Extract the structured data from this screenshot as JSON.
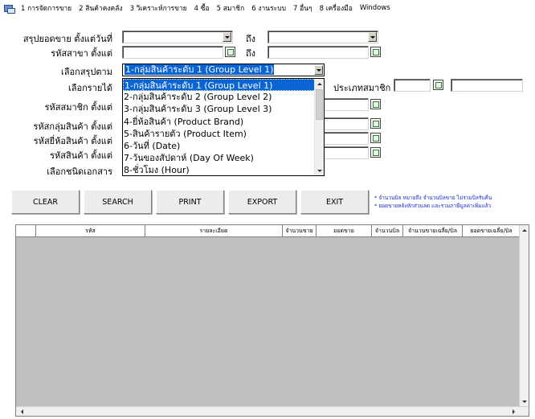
{
  "menu": {
    "items": [
      "1 การจัดการขาย",
      "2 สินค้าคงคลัง",
      "3 วิเคราะห์การขาย",
      "4 ซื้อ",
      "5 สมาชิก",
      "6 งานระบบ",
      "7 อื่นๆ",
      "8 เครื่องมือ",
      "Windows"
    ]
  },
  "form": {
    "labels": {
      "summary_date": "สรุปยอดขาย ตั้งแต่วันที่",
      "branch_code": "รหัสสาขา ตั้งแต่",
      "select_summary": "เลือกสรุปตาม",
      "select_tx": "เลือกรายได้",
      "member_code": "รหัสสมาชิก ตั้งแต่",
      "product_group": "รหัสกลุ่มสินค้า ตั้งแต่",
      "brand_code": "รหัสยี่ห้อสินค้า ตั้งแต่",
      "product_code": "รหัสสินค้า ตั้งแต่",
      "doc_type": "เลือกชนิดเอกสาร",
      "to1": "ถึง",
      "to2": "ถึง",
      "member_type": "ประเภทสมาชิก"
    },
    "summary_selected": "1-กลุ่มสินค้าระดับ 1 (Group Level 1)",
    "summary_options": [
      "1-กลุ่มสินค้าระดับ 1 (Group Level 1)",
      "2-กลุ่มสินค้าระดับ 2 (Group Level 2)",
      "3-กลุ่มสินค้าระดับ 3 (Group Level 3)",
      "4-ยี่ห้อสินค้า (Product Brand)",
      "5-สินค้ารายตัว (Product Item)",
      "6-วันที่ (Date)",
      "7-วันของสัปดาห์ (Day Of Week)",
      "8-ชั่วโมง (Hour)"
    ]
  },
  "buttons": {
    "clear": "CLEAR",
    "search": "SEARCH",
    "print": "PRINT",
    "export": "EXPORT",
    "exit": "EXIT"
  },
  "note": {
    "line1": "* จำนวนบิล หมายถึง จำนวนบิลขาย ไม่รวมบิลรับคืน",
    "line2": "* ยอดขายหลังหักส่วนลด และรวมภาษีมูลค่าเพิ่มแล้ว"
  },
  "grid": {
    "columns": [
      "รหัส",
      "รายละเอียด",
      "จำนวนขาย",
      "ยอดขาย",
      "จำนวนบิล",
      "จำนวนขายเฉลี่ย/บิล",
      "ยอดขายเฉลี่ย/บิล"
    ]
  },
  "colors": {
    "selection": "#0a64d4",
    "grid_bg": "#c0c0c0",
    "note_text": "#1a2ccc"
  }
}
